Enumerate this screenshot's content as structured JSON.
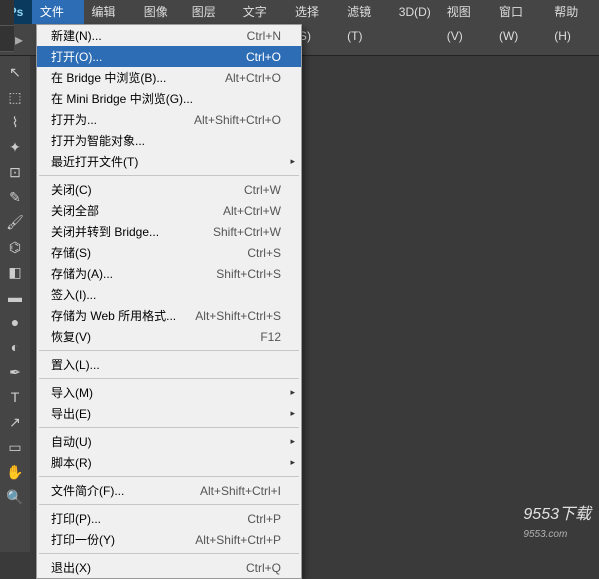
{
  "menubar": {
    "logo": "Ps",
    "items": [
      "文件(F)",
      "编辑(E)",
      "图像(I)",
      "图层(L)",
      "文字(Y)",
      "选择(S)",
      "滤镜(T)",
      "3D(D)",
      "视图(V)",
      "窗口(W)",
      "帮助(H)"
    ]
  },
  "dropdown": {
    "groups": [
      [
        {
          "label": "新建(N)...",
          "shortcut": "Ctrl+N",
          "sub": false
        },
        {
          "label": "打开(O)...",
          "shortcut": "Ctrl+O",
          "sub": false,
          "highlight": true
        },
        {
          "label": "在 Bridge 中浏览(B)...",
          "shortcut": "Alt+Ctrl+O",
          "sub": false
        },
        {
          "label": "在 Mini Bridge 中浏览(G)...",
          "shortcut": "",
          "sub": false
        },
        {
          "label": "打开为...",
          "shortcut": "Alt+Shift+Ctrl+O",
          "sub": false
        },
        {
          "label": "打开为智能对象...",
          "shortcut": "",
          "sub": false
        },
        {
          "label": "最近打开文件(T)",
          "shortcut": "",
          "sub": true
        }
      ],
      [
        {
          "label": "关闭(C)",
          "shortcut": "Ctrl+W",
          "sub": false
        },
        {
          "label": "关闭全部",
          "shortcut": "Alt+Ctrl+W",
          "sub": false
        },
        {
          "label": "关闭并转到 Bridge...",
          "shortcut": "Shift+Ctrl+W",
          "sub": false
        },
        {
          "label": "存储(S)",
          "shortcut": "Ctrl+S",
          "sub": false
        },
        {
          "label": "存储为(A)...",
          "shortcut": "Shift+Ctrl+S",
          "sub": false
        },
        {
          "label": "签入(I)...",
          "shortcut": "",
          "sub": false
        },
        {
          "label": "存储为 Web 所用格式...",
          "shortcut": "Alt+Shift+Ctrl+S",
          "sub": false
        },
        {
          "label": "恢复(V)",
          "shortcut": "F12",
          "sub": false
        }
      ],
      [
        {
          "label": "置入(L)...",
          "shortcut": "",
          "sub": false
        }
      ],
      [
        {
          "label": "导入(M)",
          "shortcut": "",
          "sub": true
        },
        {
          "label": "导出(E)",
          "shortcut": "",
          "sub": true
        }
      ],
      [
        {
          "label": "自动(U)",
          "shortcut": "",
          "sub": true
        },
        {
          "label": "脚本(R)",
          "shortcut": "",
          "sub": true
        }
      ],
      [
        {
          "label": "文件简介(F)...",
          "shortcut": "Alt+Shift+Ctrl+I",
          "sub": false
        }
      ],
      [
        {
          "label": "打印(P)...",
          "shortcut": "Ctrl+P",
          "sub": false
        },
        {
          "label": "打印一份(Y)",
          "shortcut": "Alt+Shift+Ctrl+P",
          "sub": false
        }
      ],
      [
        {
          "label": "退出(X)",
          "shortcut": "Ctrl+Q",
          "sub": false
        }
      ]
    ]
  },
  "watermark": {
    "main": "9553下载",
    "sub": "9553.com"
  },
  "toolbox": {
    "tools": [
      "move",
      "marquee",
      "lasso",
      "wand",
      "crop",
      "eyedropper",
      "brush",
      "stamp",
      "eraser",
      "gradient",
      "blur",
      "dodge",
      "pen",
      "type",
      "path",
      "shape",
      "hand",
      "zoom"
    ]
  }
}
